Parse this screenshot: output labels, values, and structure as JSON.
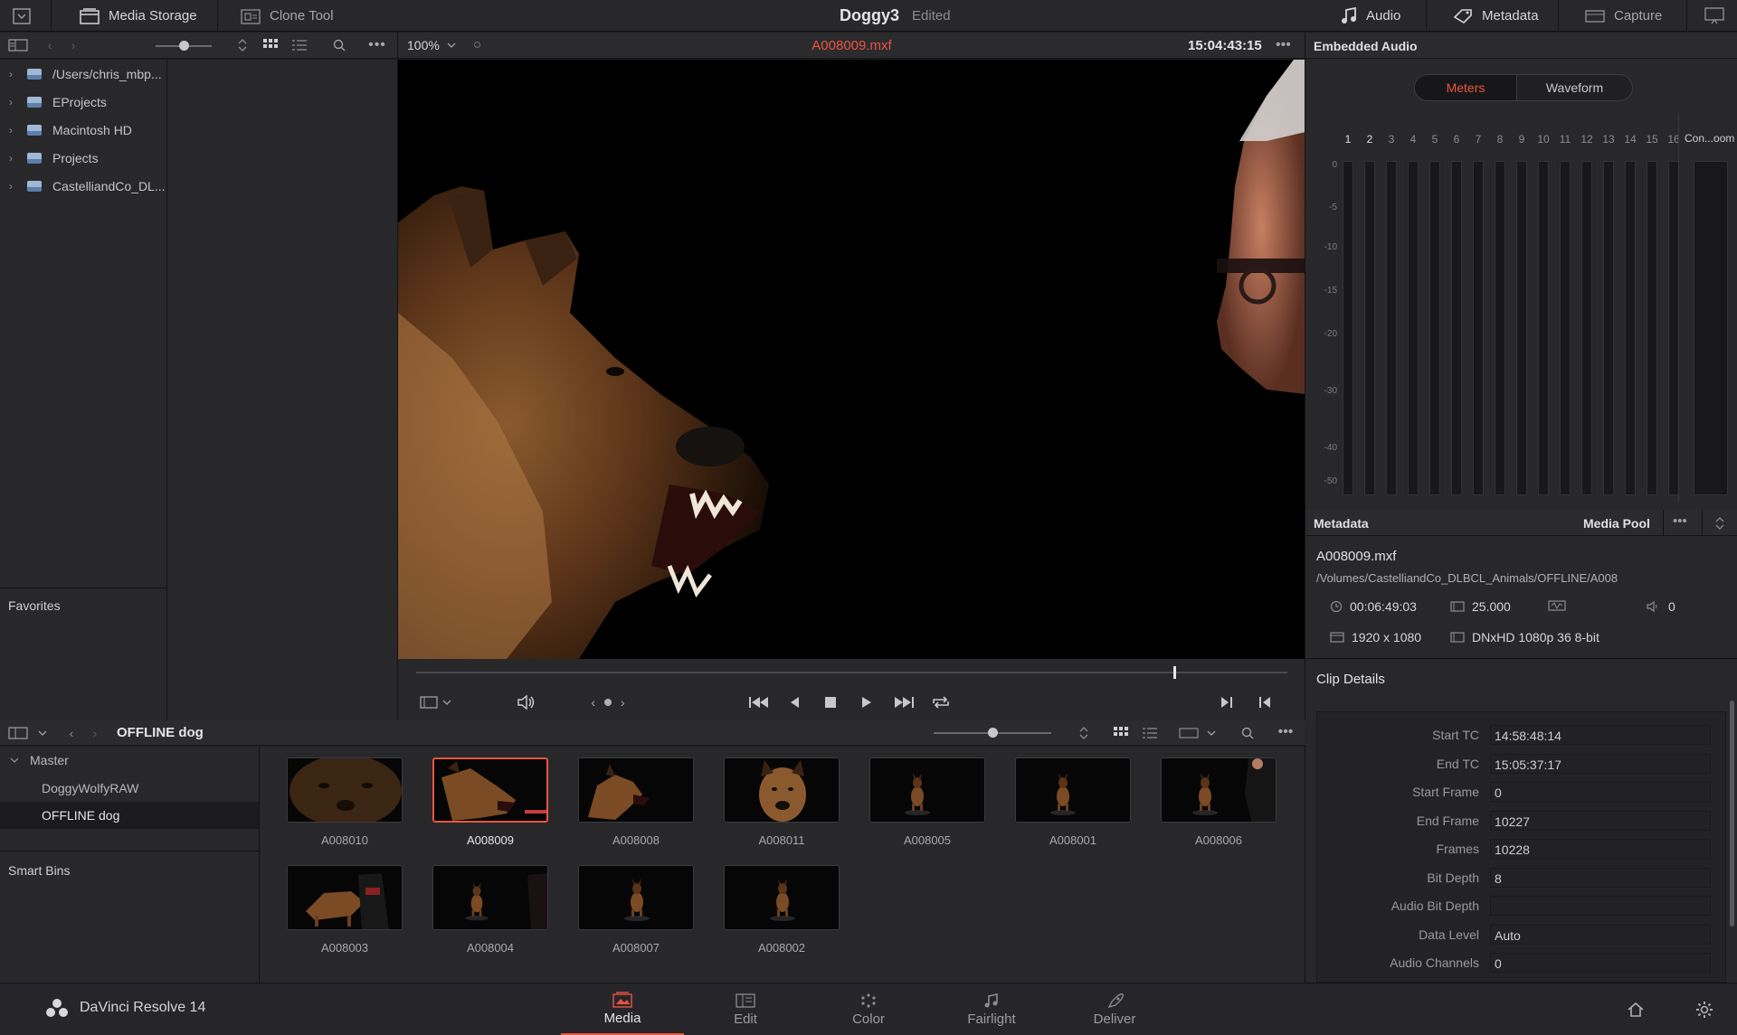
{
  "topbar": {
    "media_storage": "Media Storage",
    "clone_tool": "Clone Tool",
    "project_name": "Doggy3",
    "project_state": "Edited",
    "audio": "Audio",
    "metadata": "Metadata",
    "capture": "Capture"
  },
  "storage": {
    "items": [
      {
        "label": "/Users/chris_mbp..."
      },
      {
        "label": "EProjects"
      },
      {
        "label": "Macintosh HD"
      },
      {
        "label": "Projects"
      },
      {
        "label": "CastelliandCo_DL..."
      }
    ],
    "favorites": "Favorites"
  },
  "viewer": {
    "zoom": "100%",
    "clip_name": "A008009.mxf",
    "timecode": "15:04:43:15",
    "playhead_position": 0.87
  },
  "audio_panel": {
    "title": "Embedded Audio",
    "tab_meters": "Meters",
    "tab_waveform": "Waveform",
    "channels": [
      "1",
      "2",
      "3",
      "4",
      "5",
      "6",
      "7",
      "8",
      "9",
      "10",
      "11",
      "12",
      "13",
      "14",
      "15",
      "16"
    ],
    "control_room": "Con...oom",
    "db_scale": [
      "0",
      "-5",
      "-10",
      "-15",
      "-20",
      "-30",
      "-40",
      "-50"
    ]
  },
  "metadata": {
    "title": "Metadata",
    "media_pool_tab": "Media Pool",
    "file_name": "A008009.mxf",
    "file_path": "/Volumes/CastelliandCo_DLBCL_Animals/OFFLINE/A008",
    "duration": "00:06:49:03",
    "fps": "25.000",
    "audio_ch": "0",
    "resolution": "1920 x 1080",
    "codec": "DNxHD 1080p 36 8-bit",
    "clip_details_title": "Clip Details",
    "fields": [
      {
        "label": "Start TC",
        "value": "14:58:48:14"
      },
      {
        "label": "End TC",
        "value": "15:05:37:17"
      },
      {
        "label": "Start Frame",
        "value": "0"
      },
      {
        "label": "End Frame",
        "value": "10227"
      },
      {
        "label": "Frames",
        "value": "10228"
      },
      {
        "label": "Bit Depth",
        "value": "8"
      },
      {
        "label": "Audio Bit Depth",
        "value": ""
      },
      {
        "label": "Data Level",
        "value": "Auto"
      },
      {
        "label": "Audio Channels",
        "value": "0"
      }
    ]
  },
  "bins": {
    "current_bin": "OFFLINE dog",
    "master": "Master",
    "items": [
      {
        "label": "DoggyWolfyRAW"
      },
      {
        "label": "OFFLINE dog"
      }
    ],
    "smart_bins": "Smart Bins"
  },
  "clips": [
    {
      "name": "A008010"
    },
    {
      "name": "A008009"
    },
    {
      "name": "A008008"
    },
    {
      "name": "A008011"
    },
    {
      "name": "A008005"
    },
    {
      "name": "A008001"
    },
    {
      "name": "A008006"
    },
    {
      "name": "A008003"
    },
    {
      "name": "A008004"
    },
    {
      "name": "A008007"
    },
    {
      "name": "A008002"
    }
  ],
  "bottom_nav": {
    "app_name": "DaVinci Resolve 14",
    "pages": [
      {
        "label": "Media"
      },
      {
        "label": "Edit"
      },
      {
        "label": "Color"
      },
      {
        "label": "Fairlight"
      },
      {
        "label": "Deliver"
      }
    ]
  },
  "colors": {
    "accent": "#e8553e",
    "panel": "#28282b",
    "background": "#1e1e20"
  }
}
